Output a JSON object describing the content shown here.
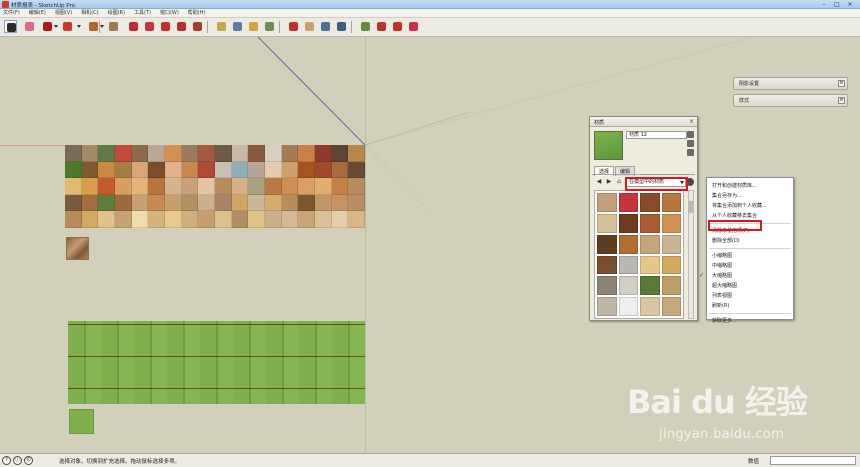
{
  "window": {
    "title": "材质报表 - SketchUp Pro",
    "controls": [
      "–",
      "□",
      "×"
    ]
  },
  "menubar": {
    "items": [
      "文件(F)",
      "编辑(E)",
      "视图(V)",
      "相机(C)",
      "绘图(R)",
      "工具(T)",
      "窗口(W)",
      "帮助(H)"
    ]
  },
  "toolbar": {
    "tools": [
      {
        "name": "select-tool-icon",
        "color": "#2a2a2a",
        "active": true
      },
      {
        "name": "eraser-tool-icon",
        "color": "#d86a8c"
      },
      {
        "name": "pencil-tool-icon",
        "color": "#b01c1c"
      },
      {
        "name": "arc-tool-icon",
        "color": "#c8382b"
      },
      {
        "name": "shapes-tool-icon",
        "color": "#b6642c"
      },
      {
        "name": "pushpull-tool-icon",
        "color": "#9a7d52"
      },
      {
        "name": "move-tool-icon",
        "color": "#c3283a"
      },
      {
        "name": "rotate-tool-icon",
        "color": "#c9373a"
      },
      {
        "name": "scale-tool-icon",
        "color": "#cf2a2a"
      },
      {
        "name": "offset-tool-icon",
        "color": "#b8302b"
      },
      {
        "name": "followme-tool-icon",
        "color": "#a83b2e"
      },
      {
        "name": "tape-measure-icon",
        "color": "#caa64a"
      },
      {
        "name": "dimension-tool-icon",
        "color": "#5d7da3"
      },
      {
        "name": "protractor-tool-icon",
        "color": "#d4a43a"
      },
      {
        "name": "text-tool-icon",
        "color": "#6b8f4a"
      },
      {
        "name": "orbit-tool-icon",
        "color": "#c0302e"
      },
      {
        "name": "pan-tool-icon",
        "color": "#c7a46a"
      },
      {
        "name": "zoom-tool-icon",
        "color": "#4e6f96"
      },
      {
        "name": "zoom-extents-icon",
        "color": "#3d5e88"
      },
      {
        "name": "warehouse-icon",
        "color": "#6a8a42"
      },
      {
        "name": "share-model-icon",
        "color": "#b23a2c"
      },
      {
        "name": "extension-warehouse-icon",
        "color": "#c3322a"
      },
      {
        "name": "layout-send-icon",
        "color": "#ce2f45"
      }
    ]
  },
  "trays": [
    {
      "label": "阴影设置",
      "button": "≡"
    },
    {
      "label": "样式",
      "button": "≡"
    }
  ],
  "materials": {
    "window_title": "材质",
    "close": "×",
    "current_name": "材质 12",
    "tabs": [
      "选择",
      "编辑"
    ],
    "nav": {
      "back": "◀",
      "forward": "▶",
      "home": "⌂"
    },
    "collection": "在模型中的材质",
    "preview_color": "#6fa645"
  },
  "context_menu": {
    "items": [
      {
        "label": "打开和创建材质库...",
        "checked": false
      },
      {
        "label": "集合另存为...",
        "checked": false
      },
      {
        "label": "将集合添加到个人收藏...",
        "checked": false
      },
      {
        "label": "从个人收藏移去集合",
        "checked": false
      },
      {
        "sep": true
      },
      {
        "label": "清除未使用项(P)",
        "checked": false,
        "highlight": true
      },
      {
        "label": "删除全部(D)",
        "checked": false
      },
      {
        "sep": true
      },
      {
        "label": "小缩略图",
        "checked": false
      },
      {
        "label": "中缩略图",
        "checked": false
      },
      {
        "label": "大缩略图",
        "checked": true
      },
      {
        "label": "超大缩略图",
        "checked": false
      },
      {
        "label": "列表视图",
        "checked": false
      },
      {
        "label": "刷新(R)",
        "checked": false
      },
      {
        "sep": true
      },
      {
        "label": "获取更多...",
        "checked": false
      }
    ]
  },
  "statusbar": {
    "icons": [
      "?",
      "ⓘ",
      "©"
    ],
    "hint": "选择对象。切换到扩充选择。拖动鼠标选择多项。",
    "measure_label": "数值",
    "measure_value": ""
  },
  "watermark": {
    "logo": "Bai du 经验",
    "url": "jingyan.baidu.com"
  }
}
